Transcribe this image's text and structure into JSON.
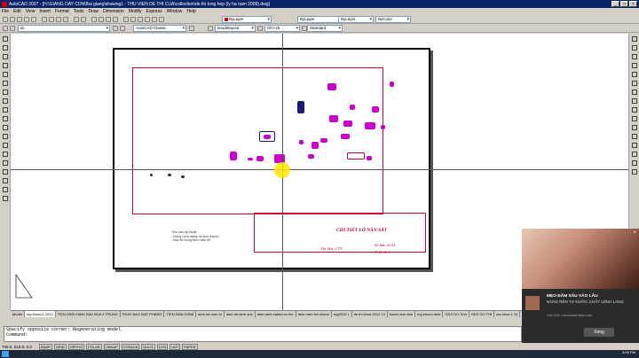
{
  "window": {
    "title": "AutoCAD 2007 - [H:\\GIANG DAY CDN\\Bai giang\\drawing1 - THU VIEN DE THI CUA\\collection\\de thi tong hop (ly ha nam 2009).dwg]",
    "controls": [
      "_",
      "□",
      "×"
    ]
  },
  "menu": {
    "items": [
      "File",
      "Edit",
      "View",
      "Insert",
      "Format",
      "Tools",
      "Draw",
      "Dimension",
      "Modify",
      "Express",
      "Window",
      "Help"
    ]
  },
  "toolbar": {
    "layer": "ByLayer",
    "linetype": "ByLayer",
    "lineweight": "ByLayer",
    "plotstyle": "ByColor",
    "layer_current": "dc",
    "workspace": "AutoCAD Classic",
    "textstyle": "tieudelayout",
    "dimstyle": "ISO-25",
    "tablestyle": "Standard"
  },
  "drawing": {
    "title_block": {
      "part_name": "CHI TIẾT LÕ NĂN SẮT",
      "material": "Vật liệu: CT3",
      "sheet_no": "Số bản vẽ:01",
      "scale": "Tỉ lệ: 2: 1"
    },
    "notes": [
      "Yêu cầu kỹ thuật",
      "- Đúng hình dáng và kích thước",
      "- Đạt độ bóng theo bản vẽ"
    ]
  },
  "tabs": [
    "Model",
    "mg khuon1 2013",
    "TIEN DINH HINH DAU BUA 4 TRUNG",
    "PHAY BAO MAT PHANG",
    "TIEN DDN DSN8",
    "dem tot mon tu",
    "dem tot dem sua",
    "dem ranh cabbd co the",
    "dem ranh tim chanh",
    "mg2019 1",
    "de thi khoa 2012 13",
    "khuon bon tinh",
    "mg khuon hinh",
    "GDS DO Tinh",
    "GDS DO THI",
    "ma khoa 1 10"
  ],
  "command": {
    "line1": "Specify opposite corner: Regenerating model.",
    "line2": "Command:"
  },
  "status": {
    "coords": "758.9, 515.8, 0.0",
    "buttons": [
      "SNAP",
      "GRID",
      "ORTHO",
      "POLAR",
      "OSNAP",
      "OTRACK",
      "DUCS",
      "DYN",
      "LWT",
      "PAPER"
    ]
  },
  "ad": {
    "headline": "MẸO ĐÂM SÂU VÀO LÂU",
    "body": "NÀNG RÊN TO NƯỚC CHẢY LÊNH LÁNG",
    "source": "Cốc Cốc • download.afert.com",
    "dismiss": "Xong"
  },
  "taskbar": {
    "time": "5:09 PM"
  },
  "colors": {
    "title_bar": "#0a246a",
    "frame_red": "#d00030",
    "parts_magenta": "#cc00cc",
    "cursor_highlight": "#ffe600"
  }
}
